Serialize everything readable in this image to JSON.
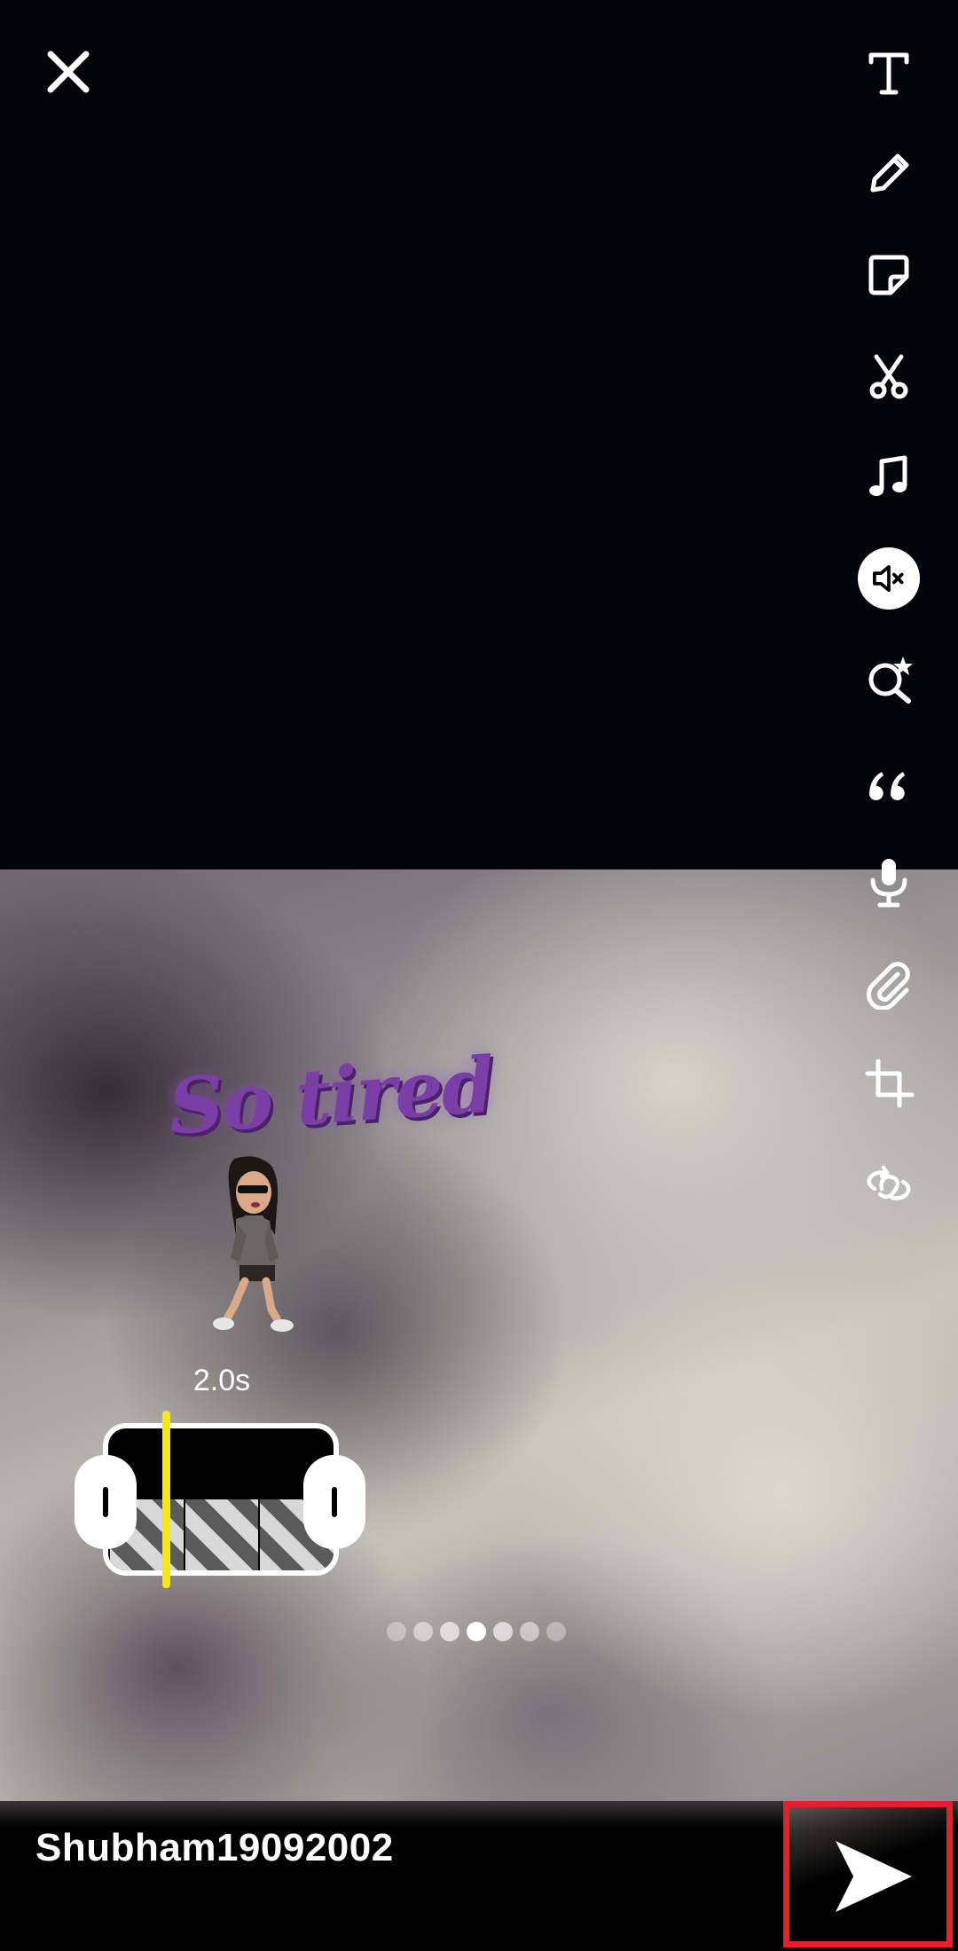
{
  "editor": {
    "close_icon": "close-icon",
    "tools": [
      {
        "name": "text-tool",
        "icon": "text-icon"
      },
      {
        "name": "draw-tool",
        "icon": "pencil-icon"
      },
      {
        "name": "sticker-tool",
        "icon": "sticker-icon"
      },
      {
        "name": "scissors-tool",
        "icon": "scissors-icon"
      },
      {
        "name": "music-tool",
        "icon": "music-note-icon"
      },
      {
        "name": "mute-tool",
        "icon": "speaker-mute-icon"
      },
      {
        "name": "lens-tool",
        "icon": "lens-search-star-icon"
      },
      {
        "name": "quote-tool",
        "icon": "quote-icon"
      },
      {
        "name": "voice-tool",
        "icon": "microphone-icon"
      },
      {
        "name": "attach-tool",
        "icon": "paperclip-icon"
      },
      {
        "name": "crop-tool",
        "icon": "crop-icon"
      },
      {
        "name": "loop-tool",
        "icon": "loop-icon"
      }
    ]
  },
  "sticker": {
    "text": "So tired"
  },
  "trim": {
    "duration_label": "2.0s"
  },
  "pager": {
    "count": 7,
    "active_index": 3
  },
  "footer": {
    "username": "Shubham19092002",
    "send_icon": "send-arrow-icon"
  },
  "colors": {
    "playhead": "#f6e812",
    "highlight_border": "#e5202a",
    "sticker_text": "#7a3fa6"
  }
}
